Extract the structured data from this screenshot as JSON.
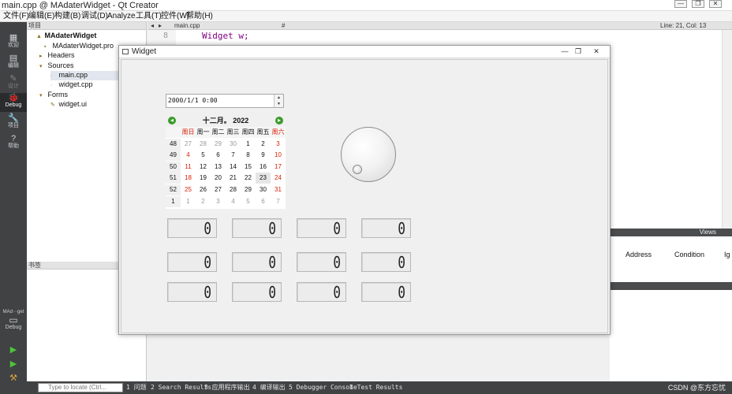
{
  "window": {
    "title": "main.cpp @ MAdaterWidget - Qt Creator",
    "controls": [
      "—",
      "❐",
      "✕"
    ]
  },
  "menu": [
    "文件(F)",
    "编辑(E)",
    "构建(B)",
    "调试(D)",
    "Analyze",
    "工具(T)",
    "控件(W)",
    "帮助(H)"
  ],
  "modes": [
    {
      "icon": "grid-icon",
      "glyph": "▦",
      "label": "欢迎"
    },
    {
      "icon": "edit-icon",
      "glyph": "▤",
      "label": "编辑"
    },
    {
      "icon": "design-icon",
      "glyph": "✎",
      "label": "设计"
    },
    {
      "icon": "debug-icon",
      "glyph": "🐞",
      "label": "Debug"
    },
    {
      "icon": "wrench-icon",
      "glyph": "🔧",
      "label": "项目"
    },
    {
      "icon": "help-icon",
      "glyph": "?",
      "label": "帮助"
    }
  ],
  "project": {
    "header": "项目",
    "items": [
      {
        "label": "MAdaterWidget",
        "bold": true,
        "icon": "project-icon"
      },
      {
        "label": "MAdaterWidget.pro",
        "icon": "pro-file-icon"
      },
      {
        "label": "Headers",
        "icon": "folder-icon"
      },
      {
        "label": "Sources",
        "icon": "folder-icon"
      },
      {
        "label": "main.cpp",
        "icon": "cpp-file-icon"
      },
      {
        "label": "widget.cpp",
        "icon": "cpp-file-icon"
      },
      {
        "label": "Forms",
        "icon": "folder-icon"
      },
      {
        "label": "widget.ui",
        "icon": "ui-file-icon"
      }
    ]
  },
  "bookmarks": {
    "header": "书签"
  },
  "kit": {
    "label": "MAd⋯get",
    "sub": "Debug"
  },
  "editor": {
    "filename": "main.cpp",
    "symbol": "#",
    "position": "Line: 21, Col: 13",
    "line_number": "8",
    "code": "Widget w;"
  },
  "debugger": {
    "views_label": "Views",
    "columns": [
      "Address",
      "Condition",
      "Ig"
    ]
  },
  "status": {
    "locate_placeholder": "Type to locate (Ctrl...",
    "tabs": [
      "1 问题",
      "2 Search Results",
      "3 应用程序输出",
      "4 编译输出",
      "5 Debugger Console",
      "8 Test Results"
    ],
    "watermark": "CSDN @东方忘忧"
  },
  "widget": {
    "title": "Widget",
    "datetime_value": "2000/1/1 0:00",
    "calendar": {
      "month_label": "十二月。 2022",
      "weekdays": [
        "周日",
        "周一",
        "周二",
        "周三",
        "周四",
        "周五",
        "周六"
      ],
      "weeks": [
        {
          "wk": "48",
          "days": [
            "27",
            "28",
            "29",
            "30",
            "1",
            "2",
            "3"
          ]
        },
        {
          "wk": "49",
          "days": [
            "4",
            "5",
            "6",
            "7",
            "8",
            "9",
            "10"
          ]
        },
        {
          "wk": "50",
          "days": [
            "11",
            "12",
            "13",
            "14",
            "15",
            "16",
            "17"
          ]
        },
        {
          "wk": "51",
          "days": [
            "18",
            "19",
            "20",
            "21",
            "22",
            "23",
            "24"
          ]
        },
        {
          "wk": "52",
          "days": [
            "25",
            "26",
            "27",
            "28",
            "29",
            "30",
            "31"
          ]
        },
        {
          "wk": "1",
          "days": [
            "1",
            "2",
            "3",
            "4",
            "5",
            "6",
            "7"
          ]
        }
      ],
      "selected": "23"
    },
    "lcd_values": [
      "0",
      "0",
      "0",
      "0",
      "0",
      "0",
      "0",
      "0",
      "0",
      "0",
      "0",
      "0"
    ]
  }
}
